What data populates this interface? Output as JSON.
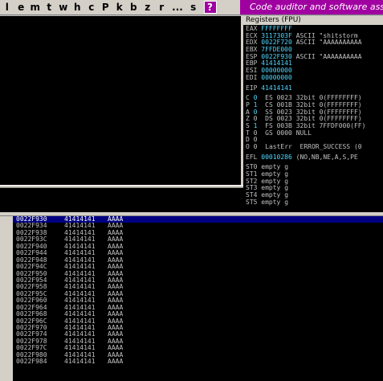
{
  "toolbar": {
    "buttons": [
      "l",
      "e",
      "m",
      "t",
      "w",
      "h",
      "c",
      "P",
      "k",
      "b",
      "z",
      "r",
      "...",
      "s"
    ],
    "help": "?"
  },
  "banner": "Code auditor and software assessment",
  "registers": {
    "title": "Registers (FPU)",
    "general": [
      {
        "name": "EAX",
        "value": "FFFFFFFF",
        "info": ""
      },
      {
        "name": "ECX",
        "value": "3117303F",
        "info": "ASCII \"shitstorm"
      },
      {
        "name": "EDX",
        "value": "0022F720",
        "info": "ASCII \"AAAAAAAAAA"
      },
      {
        "name": "EBX",
        "value": "7FFDE000",
        "info": ""
      },
      {
        "name": "ESP",
        "value": "0022F930",
        "info": "ASCII \"AAAAAAAAAA"
      },
      {
        "name": "EBP",
        "value": "41414141",
        "info": ""
      },
      {
        "name": "ESI",
        "value": "00000000",
        "info": ""
      },
      {
        "name": "EDI",
        "value": "00000000",
        "info": ""
      }
    ],
    "eip": {
      "name": "EIP",
      "value": "41414141"
    },
    "flags": [
      {
        "f": "C",
        "v": "0",
        "seg": "ES",
        "sel": "0023",
        "bits": "32bit",
        "info": "0(FFFFFFFF)"
      },
      {
        "f": "P",
        "v": "1",
        "seg": "CS",
        "sel": "001B",
        "bits": "32bit",
        "info": "0(FFFFFFFF)"
      },
      {
        "f": "A",
        "v": "0",
        "seg": "SS",
        "sel": "0023",
        "bits": "32bit",
        "info": "0(FFFFFFFF)"
      },
      {
        "f": "Z",
        "v": "0",
        "seg": "DS",
        "sel": "0023",
        "bits": "32bit",
        "info": "0(FFFFFFFF)"
      },
      {
        "f": "S",
        "v": "1",
        "seg": "FS",
        "sel": "003B",
        "bits": "32bit",
        "info": "7FFDF000(FF)"
      },
      {
        "f": "T",
        "v": "0",
        "seg": "GS",
        "sel": "0000",
        "bits": "NULL",
        "info": ""
      },
      {
        "f": "D",
        "v": "0",
        "seg": "",
        "sel": "",
        "bits": "",
        "info": ""
      },
      {
        "f": "O",
        "v": "0",
        "seg": "LastErr",
        "sel": "",
        "bits": "ERROR_SUCCESS",
        "info": "(0"
      }
    ],
    "efl": {
      "name": "EFL",
      "value": "00010286",
      "info": "(NO,NB,NE,A,S,PE"
    },
    "fpu": [
      {
        "name": "ST0",
        "state": "empty",
        "val": "g"
      },
      {
        "name": "ST1",
        "state": "empty",
        "val": "g"
      },
      {
        "name": "ST2",
        "state": "empty",
        "val": "g"
      },
      {
        "name": "ST3",
        "state": "empty",
        "val": "g"
      },
      {
        "name": "ST4",
        "state": "empty",
        "val": "g"
      },
      {
        "name": "ST5",
        "state": "empty",
        "val": "g"
      }
    ]
  },
  "stack": {
    "rows": [
      {
        "addr": "0022F930",
        "val": "41414141",
        "ascii": "AAAA"
      },
      {
        "addr": "0022F934",
        "val": "41414141",
        "ascii": "AAAA"
      },
      {
        "addr": "0022F938",
        "val": "41414141",
        "ascii": "AAAA"
      },
      {
        "addr": "0022F93C",
        "val": "41414141",
        "ascii": "AAAA"
      },
      {
        "addr": "0022F940",
        "val": "41414141",
        "ascii": "AAAA"
      },
      {
        "addr": "0022F944",
        "val": "41414141",
        "ascii": "AAAA"
      },
      {
        "addr": "0022F948",
        "val": "41414141",
        "ascii": "AAAA"
      },
      {
        "addr": "0022F94C",
        "val": "41414141",
        "ascii": "AAAA"
      },
      {
        "addr": "0022F950",
        "val": "41414141",
        "ascii": "AAAA"
      },
      {
        "addr": "0022F954",
        "val": "41414141",
        "ascii": "AAAA"
      },
      {
        "addr": "0022F958",
        "val": "41414141",
        "ascii": "AAAA"
      },
      {
        "addr": "0022F95C",
        "val": "41414141",
        "ascii": "AAAA"
      },
      {
        "addr": "0022F960",
        "val": "41414141",
        "ascii": "AAAA"
      },
      {
        "addr": "0022F964",
        "val": "41414141",
        "ascii": "AAAA"
      },
      {
        "addr": "0022F968",
        "val": "41414141",
        "ascii": "AAAA"
      },
      {
        "addr": "0022F96C",
        "val": "41414141",
        "ascii": "AAAA"
      },
      {
        "addr": "0022F970",
        "val": "41414141",
        "ascii": "AAAA"
      },
      {
        "addr": "0022F974",
        "val": "41414141",
        "ascii": "AAAA"
      },
      {
        "addr": "0022F978",
        "val": "41414141",
        "ascii": "AAAA"
      },
      {
        "addr": "0022F97C",
        "val": "41414141",
        "ascii": "AAAA"
      },
      {
        "addr": "0022F980",
        "val": "41414141",
        "ascii": "AAAA"
      },
      {
        "addr": "0022F984",
        "val": "41414141",
        "ascii": "AAAA"
      }
    ]
  },
  "colors": {
    "highlight": "#4fd7ff",
    "selection": "#000080",
    "banner": "#a000a0"
  }
}
